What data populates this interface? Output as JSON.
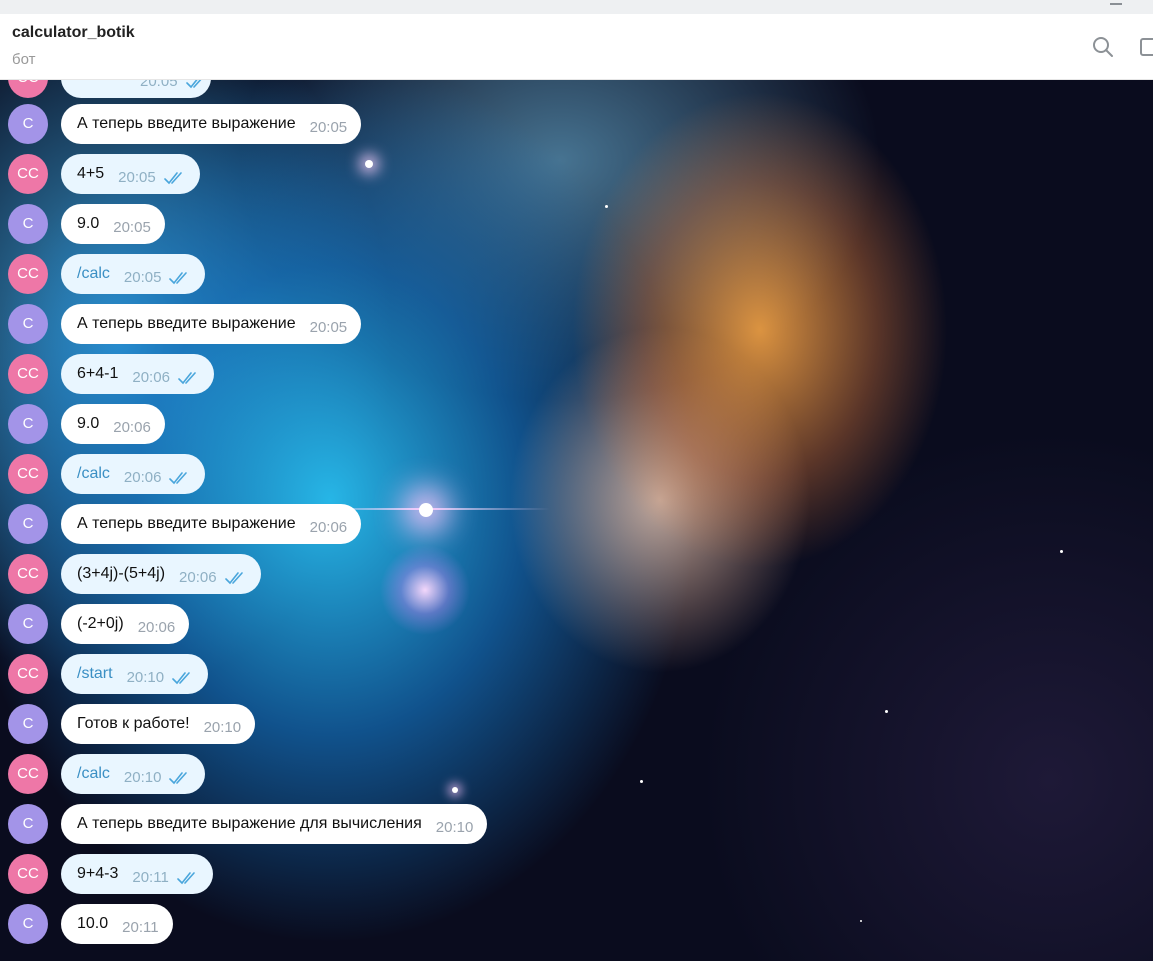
{
  "header": {
    "title": "calculator_botik",
    "subtitle": "бот",
    "search_icon": "search-icon",
    "side_panel_icon": "sidebar-icon"
  },
  "colors": {
    "bot_avatar": "#a394e8",
    "user_avatar": "#ee77a7",
    "bot_bubble": "#ffffff",
    "user_bubble": "#e9f6ff",
    "command_text": "#3a8fc4",
    "read_ticks": "#4aa6dc"
  },
  "partial_message": {
    "sender": "user",
    "avatar": "СС",
    "time": "20:05",
    "ticks_icon": "double-check-icon"
  },
  "messages": [
    {
      "sender": "bot",
      "avatar": "С",
      "text": "А теперь введите выражение",
      "time": "20:05"
    },
    {
      "sender": "user",
      "avatar": "СС",
      "text": "4+5",
      "time": "20:05"
    },
    {
      "sender": "bot",
      "avatar": "С",
      "text": "9.0",
      "time": "20:05"
    },
    {
      "sender": "user",
      "avatar": "СС",
      "text": "/calc",
      "time": "20:05"
    },
    {
      "sender": "bot",
      "avatar": "С",
      "text": "А теперь введите выражение",
      "time": "20:05"
    },
    {
      "sender": "user",
      "avatar": "СС",
      "text": "6+4-1",
      "time": "20:06"
    },
    {
      "sender": "bot",
      "avatar": "С",
      "text": "9.0",
      "time": "20:06"
    },
    {
      "sender": "user",
      "avatar": "СС",
      "text": "/calc",
      "time": "20:06"
    },
    {
      "sender": "bot",
      "avatar": "С",
      "text": "А теперь введите выражение",
      "time": "20:06"
    },
    {
      "sender": "user",
      "avatar": "СС",
      "text": "(3+4j)-(5+4j)",
      "time": "20:06"
    },
    {
      "sender": "bot",
      "avatar": "С",
      "text": "(-2+0j)",
      "time": "20:06"
    },
    {
      "sender": "user",
      "avatar": "СС",
      "text": "/start",
      "time": "20:10"
    },
    {
      "sender": "bot",
      "avatar": "С",
      "text": "Готов к работе!",
      "time": "20:10"
    },
    {
      "sender": "user",
      "avatar": "СС",
      "text": "/calc",
      "time": "20:10"
    },
    {
      "sender": "bot",
      "avatar": "С",
      "text": "А теперь введите выражение для вычисления",
      "time": "20:10"
    },
    {
      "sender": "user",
      "avatar": "СС",
      "text": "9+4-3",
      "time": "20:11"
    },
    {
      "sender": "bot",
      "avatar": "С",
      "text": "10.0",
      "time": "20:11"
    }
  ]
}
